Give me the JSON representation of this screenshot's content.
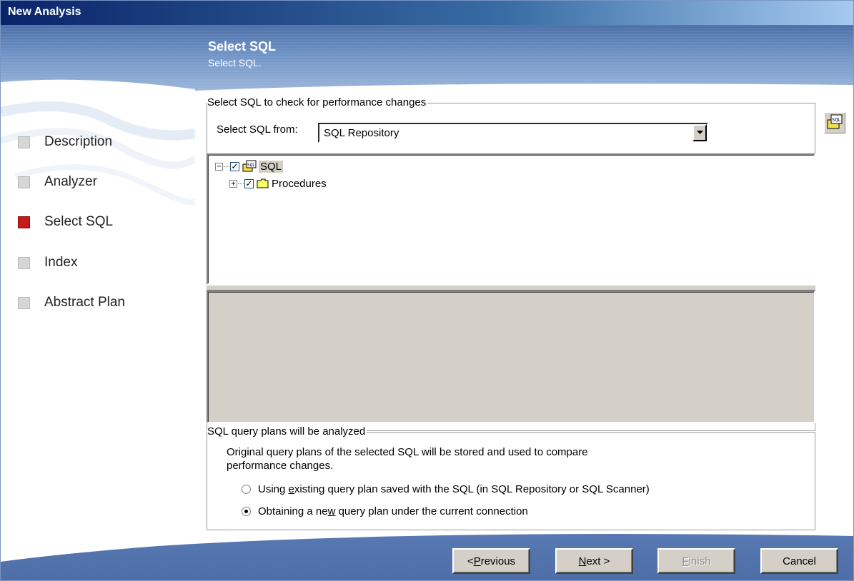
{
  "window": {
    "title": "New Analysis"
  },
  "banner": {
    "title": "Select SQL",
    "subtitle": "Select SQL."
  },
  "nav": {
    "items": [
      {
        "label": "Description",
        "active": false
      },
      {
        "label": "Analyzer",
        "active": false
      },
      {
        "label": "Select SQL",
        "active": true
      },
      {
        "label": "Index",
        "active": false
      },
      {
        "label": "Abstract Plan",
        "active": false
      }
    ]
  },
  "select_group": {
    "legend": "Select SQL to check for performance changes",
    "select_from_label": "Select SQL from:",
    "select_from_value": "SQL Repository",
    "tree": [
      {
        "label": "SQL",
        "checked": true,
        "expanded": true
      },
      {
        "label": "Procedures",
        "checked": true,
        "expanded": false
      }
    ]
  },
  "plans_group": {
    "legend": "SQL query plans will be analyzed",
    "description": "Original query plans of the selected SQL will be stored and used to compare",
    "description_line2": "performance changes.",
    "options": [
      {
        "pre": "Using ",
        "accel": "e",
        "post": "xisting query plan saved with the SQL (in SQL Repository or SQL Scanner)",
        "selected": false
      },
      {
        "pre": "Obtaining a ne",
        "accel": "w",
        "post": " query plan under the current connection",
        "selected": true
      }
    ]
  },
  "buttons": {
    "previous": {
      "pre": "< ",
      "accel": "P",
      "post": "revious"
    },
    "next": {
      "pre": "",
      "accel": "N",
      "post": "ext >"
    },
    "finish": {
      "pre": "",
      "accel": "F",
      "post": "inish"
    },
    "cancel": "Cancel"
  },
  "colors": {
    "active_step": "#c41a1a",
    "banner": "#6f93c6",
    "title_bar": "#0a246a"
  }
}
